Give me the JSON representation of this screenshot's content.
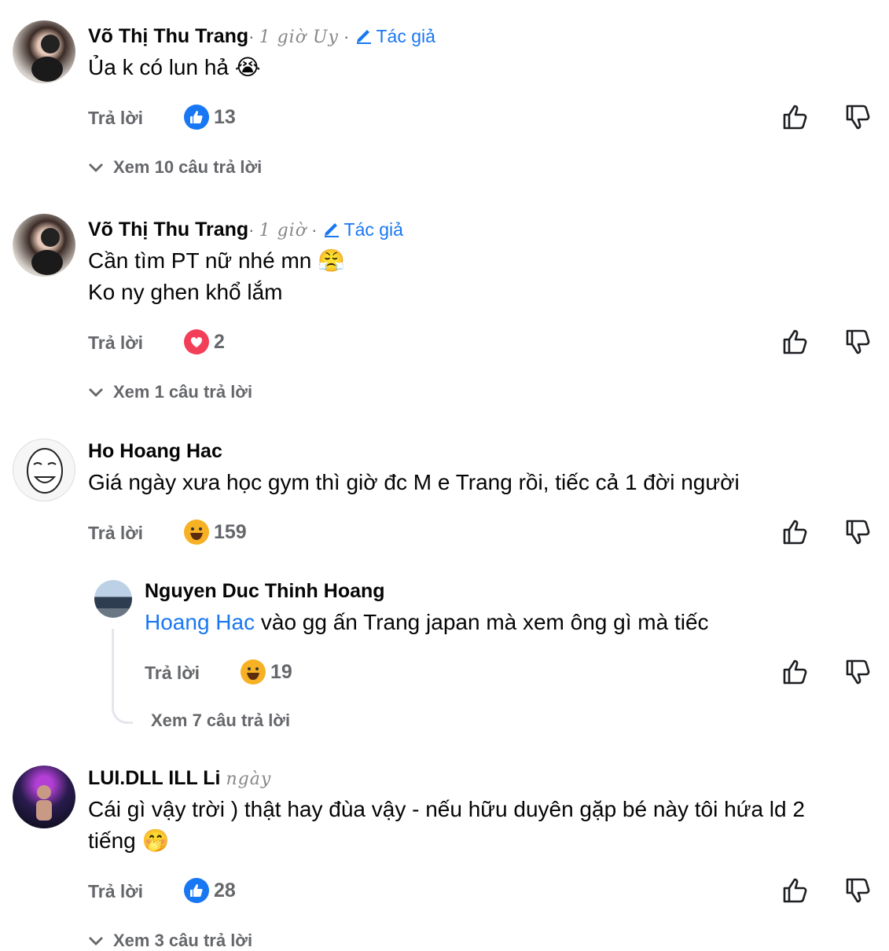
{
  "comments": [
    {
      "name": "Võ Thị Thu Trang",
      "meta": "· ",
      "time": "1 giờ Uy",
      "author_badge": "Tác giả",
      "text_lines": [
        "Ủa k có lun hả 😭"
      ],
      "reply_label": "Trả lời",
      "reaction_type": "like",
      "reaction_count": "13",
      "view_replies": "Xem 10 câu trả lời"
    },
    {
      "name": "Võ Thị Thu Trang",
      "meta": "· ",
      "time": "1 giờ",
      "author_badge": "Tác giả",
      "text_lines": [
        "Cần tìm PT nữ nhé mn 😤",
        "Ko ny ghen khổ lắm"
      ],
      "reply_label": "Trả lời",
      "reaction_type": "love",
      "reaction_count": "2",
      "view_replies": "Xem 1 câu trả lời"
    },
    {
      "name": "Ho Hoang Hac",
      "text": "Giá ngày xưa học gym thì giờ đc M e Trang rồi, tiếc cả 1 đời người",
      "reply_label": "Trả lời",
      "reaction_type": "haha",
      "reaction_count": "159",
      "reply": {
        "name": "Nguyen Duc Thinh Hoang",
        "mention": "Hoang Hac",
        "text": " vào gg ấn Trang japan mà xem ông gì mà tiếc",
        "reply_label": "Trả lời",
        "reaction_type": "haha",
        "reaction_count": "19",
        "view_replies": "Xem 7 câu trả lời"
      }
    },
    {
      "name": "LUI.DLL ILL Li",
      "time": "ngày",
      "text_lines": [
        "Cái gì vậy trời ) thật hay đùa vậy - nếu hữu duyên gặp bé này tôi hứa ld 2",
        "tiếng 🤭"
      ],
      "reply_label": "Trả lời",
      "reaction_type": "like",
      "reaction_count": "28",
      "view_replies": "Xem 3 câu trả lời"
    }
  ],
  "icons": {
    "like_btn": "thumbs-up-outline-icon",
    "dislike_btn": "thumbs-down-outline-icon",
    "chevron": "chevron-down-icon",
    "edit": "pencil-icon"
  },
  "colors": {
    "like": "#1877f2",
    "love": "#f33e58",
    "haha": "#f7b125",
    "muted": "#65676b"
  }
}
